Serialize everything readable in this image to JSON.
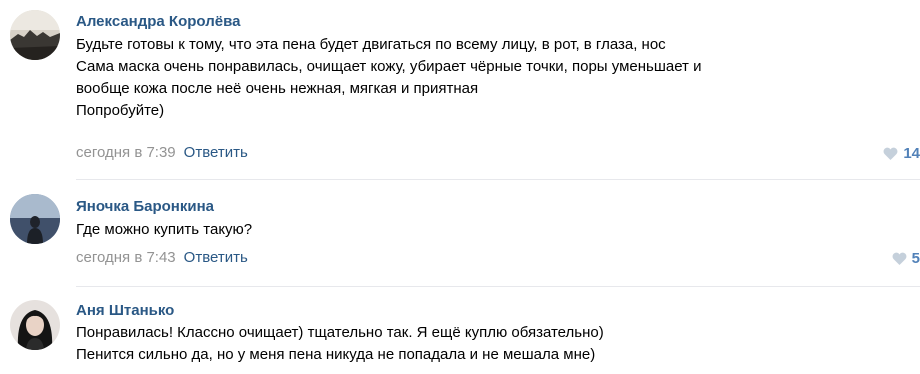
{
  "colors": {
    "author": "#2a5885",
    "link": "#2a5885",
    "time": "#939393",
    "likes": "#5181b8",
    "heart": "#c5d0db",
    "divider": "#e7e8ec"
  },
  "comments": [
    {
      "author": "Александра Королёва",
      "lines": [
        "Будьте готовы к тому, что эта пена будет двигаться по всему лицу, в рот, в глаза, нос",
        "Сама маска очень понравилась, очищает кожу, убирает чёрные точки, поры уменьшает и",
        "вообще кожа после неё очень нежная, мягкая и приятная",
        "Попробуйте)"
      ],
      "time": "сегодня в 7:39",
      "reply": "Ответить",
      "likes": "14",
      "avatar_icon": "avatar-photo"
    },
    {
      "author": "Яночка Баронкина",
      "lines": [
        "Где можно купить такую?"
      ],
      "time": "сегодня в 7:43",
      "reply": "Ответить",
      "likes": "5",
      "avatar_icon": "avatar-photo"
    },
    {
      "author": "Аня Штанько",
      "lines": [
        "Понравилась! Классно очищает) тщательно так. Я ещё куплю обязательно)",
        "Пенится сильно да, но у меня пена никуда не попадала и не мешала мне)"
      ],
      "avatar_icon": "avatar-photo"
    }
  ]
}
